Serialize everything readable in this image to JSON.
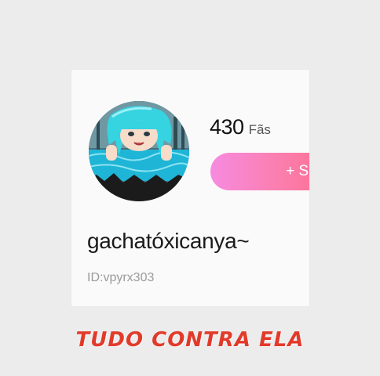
{
  "profile": {
    "fans_count": "430",
    "fans_label": "Fãs",
    "follow_label": "+ S",
    "username": "gachatóxicanya~",
    "user_id": "ID:vpyrx303"
  },
  "caption": "TUDO CONTRA ELA",
  "colors": {
    "background": "#ececec",
    "card": "#fafafa",
    "follow_gradient_start": "#f78be0",
    "follow_gradient_end": "#ff6a8f",
    "caption": "#e23a2a"
  }
}
